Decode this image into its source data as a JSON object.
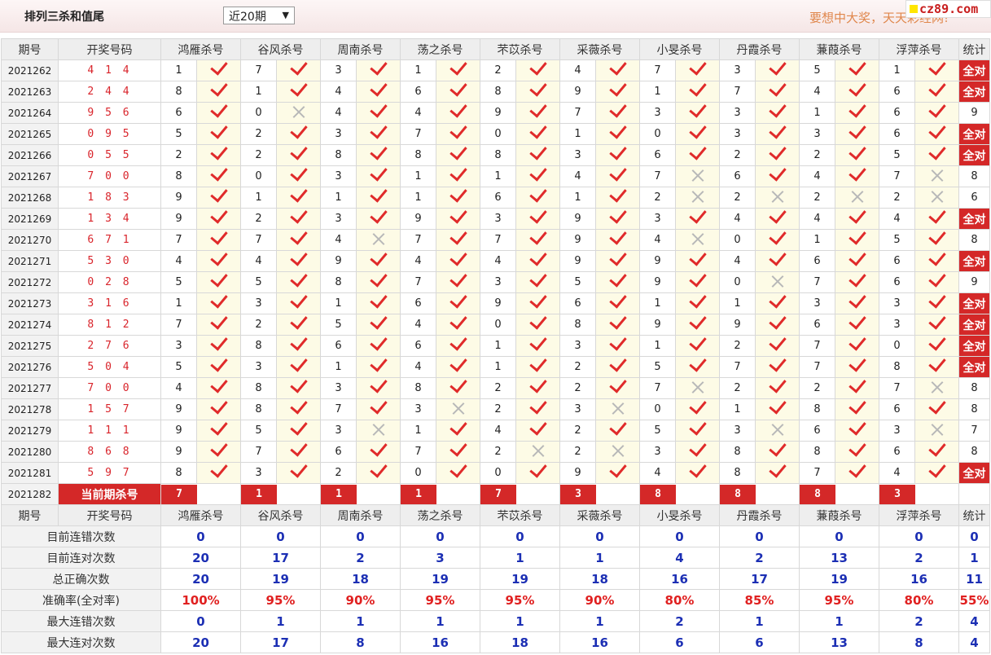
{
  "header": {
    "title": "排列三杀和值尾",
    "period_select": "近20期",
    "slogan": "要想中大奖，天天彩经网!",
    "logo_text": "cz89.com"
  },
  "columns": {
    "issue": "期号",
    "draw": "开奖号码",
    "experts": [
      "鸿雁杀号",
      "谷风杀号",
      "周南杀号",
      "荡之杀号",
      "芣苡杀号",
      "采薇杀号",
      "小旻杀号",
      "丹霞杀号",
      "蒹葭杀号",
      "浮萍杀号"
    ],
    "stat": "统计"
  },
  "rows": [
    {
      "issue": "2021262",
      "draw": "4 1 4",
      "kills": [
        1,
        7,
        3,
        1,
        2,
        4,
        7,
        3,
        5,
        1
      ],
      "ok": [
        1,
        1,
        1,
        1,
        1,
        1,
        1,
        1,
        1,
        1
      ],
      "stat": "全对"
    },
    {
      "issue": "2021263",
      "draw": "2 4 4",
      "kills": [
        8,
        1,
        4,
        6,
        8,
        9,
        1,
        7,
        4,
        6
      ],
      "ok": [
        1,
        1,
        1,
        1,
        1,
        1,
        1,
        1,
        1,
        1
      ],
      "stat": "全对"
    },
    {
      "issue": "2021264",
      "draw": "9 5 6",
      "kills": [
        6,
        0,
        4,
        4,
        9,
        7,
        3,
        3,
        1,
        6
      ],
      "ok": [
        1,
        0,
        1,
        1,
        1,
        1,
        1,
        1,
        1,
        1
      ],
      "stat": "9"
    },
    {
      "issue": "2021265",
      "draw": "0 9 5",
      "kills": [
        5,
        2,
        3,
        7,
        0,
        1,
        0,
        3,
        3,
        6
      ],
      "ok": [
        1,
        1,
        1,
        1,
        1,
        1,
        1,
        1,
        1,
        1
      ],
      "stat": "全对"
    },
    {
      "issue": "2021266",
      "draw": "0 5 5",
      "kills": [
        2,
        2,
        8,
        8,
        8,
        3,
        6,
        2,
        2,
        5
      ],
      "ok": [
        1,
        1,
        1,
        1,
        1,
        1,
        1,
        1,
        1,
        1
      ],
      "stat": "全对"
    },
    {
      "issue": "2021267",
      "draw": "7 0 0",
      "kills": [
        8,
        0,
        3,
        1,
        1,
        4,
        7,
        6,
        4,
        7
      ],
      "ok": [
        1,
        1,
        1,
        1,
        1,
        1,
        0,
        1,
        1,
        0
      ],
      "stat": "8"
    },
    {
      "issue": "2021268",
      "draw": "1 8 3",
      "kills": [
        9,
        1,
        1,
        1,
        6,
        1,
        2,
        2,
        2,
        2
      ],
      "ok": [
        1,
        1,
        1,
        1,
        1,
        1,
        0,
        0,
        0,
        0
      ],
      "stat": "6"
    },
    {
      "issue": "2021269",
      "draw": "1 3 4",
      "kills": [
        9,
        2,
        3,
        9,
        3,
        9,
        3,
        4,
        4,
        4
      ],
      "ok": [
        1,
        1,
        1,
        1,
        1,
        1,
        1,
        1,
        1,
        1
      ],
      "stat": "全对"
    },
    {
      "issue": "2021270",
      "draw": "6 7 1",
      "kills": [
        7,
        7,
        4,
        7,
        7,
        9,
        4,
        0,
        1,
        5
      ],
      "ok": [
        1,
        1,
        0,
        1,
        1,
        1,
        0,
        1,
        1,
        1
      ],
      "stat": "8"
    },
    {
      "issue": "2021271",
      "draw": "5 3 0",
      "kills": [
        4,
        4,
        9,
        4,
        4,
        9,
        9,
        4,
        6,
        6
      ],
      "ok": [
        1,
        1,
        1,
        1,
        1,
        1,
        1,
        1,
        1,
        1
      ],
      "stat": "全对"
    },
    {
      "issue": "2021272",
      "draw": "0 2 8",
      "kills": [
        5,
        5,
        8,
        7,
        3,
        5,
        9,
        0,
        7,
        6
      ],
      "ok": [
        1,
        1,
        1,
        1,
        1,
        1,
        1,
        0,
        1,
        1
      ],
      "stat": "9"
    },
    {
      "issue": "2021273",
      "draw": "3 1 6",
      "kills": [
        1,
        3,
        1,
        6,
        9,
        6,
        1,
        1,
        3,
        3
      ],
      "ok": [
        1,
        1,
        1,
        1,
        1,
        1,
        1,
        1,
        1,
        1
      ],
      "stat": "全对"
    },
    {
      "issue": "2021274",
      "draw": "8 1 2",
      "kills": [
        7,
        2,
        5,
        4,
        0,
        8,
        9,
        9,
        6,
        3
      ],
      "ok": [
        1,
        1,
        1,
        1,
        1,
        1,
        1,
        1,
        1,
        1
      ],
      "stat": "全对"
    },
    {
      "issue": "2021275",
      "draw": "2 7 6",
      "kills": [
        3,
        8,
        6,
        6,
        1,
        3,
        1,
        2,
        7,
        0
      ],
      "ok": [
        1,
        1,
        1,
        1,
        1,
        1,
        1,
        1,
        1,
        1
      ],
      "stat": "全对"
    },
    {
      "issue": "2021276",
      "draw": "5 0 4",
      "kills": [
        5,
        3,
        1,
        4,
        1,
        2,
        5,
        7,
        7,
        8
      ],
      "ok": [
        1,
        1,
        1,
        1,
        1,
        1,
        1,
        1,
        1,
        1
      ],
      "stat": "全对"
    },
    {
      "issue": "2021277",
      "draw": "7 0 0",
      "kills": [
        4,
        8,
        3,
        8,
        2,
        2,
        7,
        2,
        2,
        7
      ],
      "ok": [
        1,
        1,
        1,
        1,
        1,
        1,
        0,
        1,
        1,
        0
      ],
      "stat": "8"
    },
    {
      "issue": "2021278",
      "draw": "1 5 7",
      "kills": [
        9,
        8,
        7,
        3,
        2,
        3,
        0,
        1,
        8,
        6
      ],
      "ok": [
        1,
        1,
        1,
        0,
        1,
        0,
        1,
        1,
        1,
        1
      ],
      "stat": "8"
    },
    {
      "issue": "2021279",
      "draw": "1 1 1",
      "kills": [
        9,
        5,
        3,
        1,
        4,
        2,
        5,
        3,
        6,
        3
      ],
      "ok": [
        1,
        1,
        0,
        1,
        1,
        1,
        1,
        0,
        1,
        0
      ],
      "stat": "7"
    },
    {
      "issue": "2021280",
      "draw": "8 6 8",
      "kills": [
        9,
        7,
        6,
        7,
        2,
        2,
        3,
        8,
        8,
        6
      ],
      "ok": [
        1,
        1,
        1,
        1,
        0,
        0,
        1,
        1,
        1,
        1
      ],
      "stat": "8"
    },
    {
      "issue": "2021281",
      "draw": "5 9 7",
      "kills": [
        8,
        3,
        2,
        0,
        0,
        9,
        4,
        8,
        7,
        4
      ],
      "ok": [
        1,
        1,
        1,
        1,
        1,
        1,
        1,
        1,
        1,
        1
      ],
      "stat": "全对"
    }
  ],
  "current": {
    "issue": "2021282",
    "label": "当前期杀号",
    "kills": [
      7,
      1,
      1,
      1,
      7,
      3,
      8,
      8,
      8,
      3
    ]
  },
  "summary": [
    {
      "label": "目前连错次数",
      "values": [
        "0",
        "0",
        "0",
        "0",
        "0",
        "0",
        "0",
        "0",
        "0",
        "0"
      ],
      "total": "0",
      "red": false
    },
    {
      "label": "目前连对次数",
      "values": [
        "20",
        "17",
        "2",
        "3",
        "1",
        "1",
        "4",
        "2",
        "13",
        "2"
      ],
      "total": "1",
      "red": false
    },
    {
      "label": "总正确次数",
      "values": [
        "20",
        "19",
        "18",
        "19",
        "19",
        "18",
        "16",
        "17",
        "19",
        "16"
      ],
      "total": "11",
      "red": false
    },
    {
      "label": "准确率(全对率)",
      "values": [
        "100%",
        "95%",
        "90%",
        "95%",
        "95%",
        "90%",
        "80%",
        "85%",
        "95%",
        "80%"
      ],
      "total": "55%",
      "red": true
    },
    {
      "label": "最大连错次数",
      "values": [
        "0",
        "1",
        "1",
        "1",
        "1",
        "1",
        "2",
        "1",
        "1",
        "2"
      ],
      "total": "4",
      "red": false
    },
    {
      "label": "最大连对次数",
      "values": [
        "20",
        "17",
        "8",
        "16",
        "18",
        "16",
        "6",
        "6",
        "13",
        "8"
      ],
      "total": "4",
      "red": false
    }
  ],
  "colors": {
    "accent_red": "#d42828",
    "check_red": "#e02a2a",
    "stat_blue": "#1c2fb4",
    "cross_gray": "#b8b8b8",
    "header_gray": "#eeeeee"
  },
  "icons": {
    "correct": "check-icon",
    "wrong": "cross-icon"
  }
}
